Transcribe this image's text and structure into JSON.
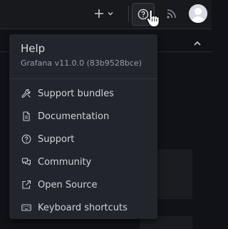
{
  "topbar": {
    "new_icon": "plus-icon",
    "new_dropdown_icon": "chevron-down-icon",
    "help_icon": "question-circle-icon",
    "news_icon": "rss-icon",
    "profile_icon": "user-avatar-icon"
  },
  "help_menu": {
    "title": "Help",
    "version": "Grafana v11.0.0 (83b9528bce)",
    "items": [
      {
        "label": "Support bundles",
        "icon": "wrench-icon"
      },
      {
        "label": "Documentation",
        "icon": "document-icon"
      },
      {
        "label": "Support",
        "icon": "question-circle-icon"
      },
      {
        "label": "Community",
        "icon": "comments-icon"
      },
      {
        "label": "Open Source",
        "icon": "external-link-icon"
      },
      {
        "label": "Keyboard shortcuts",
        "icon": "keyboard-icon"
      }
    ]
  },
  "background": {
    "collapse_icon": "chevron-up-icon"
  },
  "colors": {
    "page_bg": "#111217",
    "menu_bg": "#22252b",
    "text": "#d0d1d9",
    "muted_text": "#9a9ca8"
  }
}
